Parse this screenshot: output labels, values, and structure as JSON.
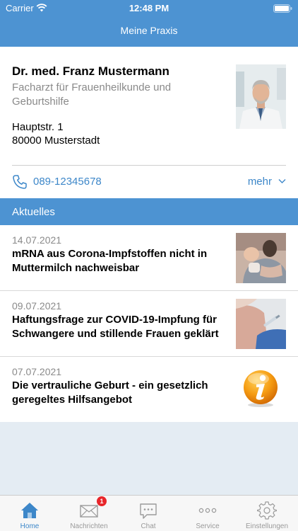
{
  "status_bar": {
    "carrier": "Carrier",
    "time": "12:48 PM"
  },
  "nav": {
    "title": "Meine Praxis"
  },
  "doctor": {
    "name": "Dr. med. Franz Mustermann",
    "specialty": "Facharzt für Frauenheilkunde und Geburtshilfe",
    "street": "Hauptstr. 1",
    "city": "80000 Musterstadt",
    "phone": "089-12345678",
    "more_label": "mehr"
  },
  "news": {
    "header": "Aktuelles",
    "items": [
      {
        "date": "14.07.2021",
        "title": "mRNA aus Corona-Impfstoffen nicht in Muttermilch nachweisbar",
        "thumbnail": "mother-baby-photo"
      },
      {
        "date": "09.07.2021",
        "title": "Haftungsfrage zur COVID-19-Impfung für Schwangere und stillende Frauen geklärt",
        "thumbnail": "vaccination-photo"
      },
      {
        "date": "07.07.2021",
        "title": "Die vertrauliche Geburt - ein gesetzlich geregeltes Hilfsangebot",
        "thumbnail": "info-icon"
      }
    ]
  },
  "tabs": [
    {
      "label": "Home",
      "icon": "home-icon",
      "active": true
    },
    {
      "label": "Nachrichten",
      "icon": "mail-icon",
      "badge": "1"
    },
    {
      "label": "Chat",
      "icon": "chat-icon"
    },
    {
      "label": "Service",
      "icon": "more-dots-icon"
    },
    {
      "label": "Einstellungen",
      "icon": "gear-icon"
    }
  ],
  "colors": {
    "accent": "#4d93d2",
    "link": "#3d87c9",
    "background": "#e4ecf3",
    "badge": "#e8262b"
  }
}
